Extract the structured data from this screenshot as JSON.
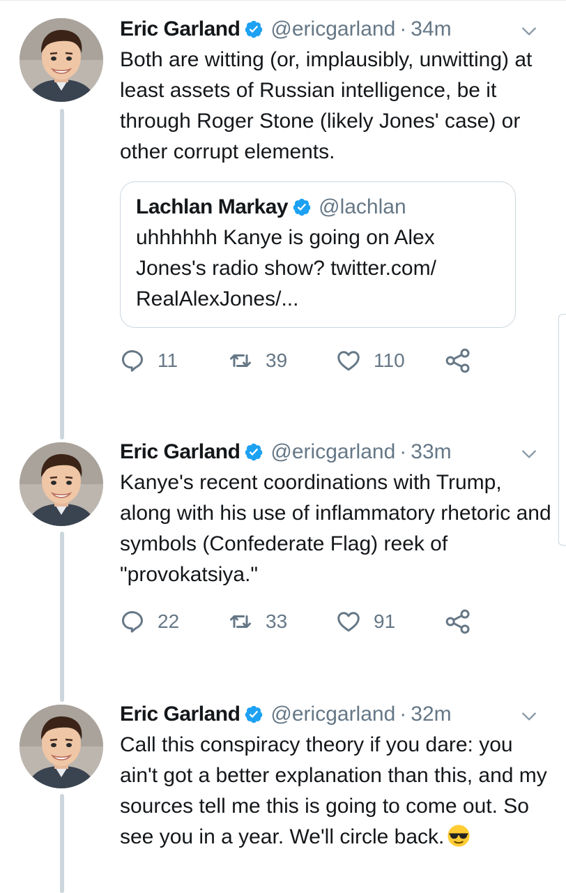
{
  "colors": {
    "accent": "#1da1f2",
    "secondary_text": "#657786",
    "thread_line": "#ccd6dd"
  },
  "tweets": [
    {
      "name": "Eric Garland",
      "handle": "@ericgarland",
      "separator": "·",
      "time": "34m",
      "text": "Both are witting (or, implausibly, unwitting) at least assets of Russian intelligence, be it through Roger Stone (likely Jones' case) or other corrupt elements.",
      "quote": {
        "name": "Lachlan Markay",
        "handle": "@lachlan",
        "text": "uhhhhhh Kanye is going on Alex Jones's radio show? twitter.com/ RealAlexJones/..."
      },
      "replies": "11",
      "retweets": "39",
      "likes": "110"
    },
    {
      "name": "Eric Garland",
      "handle": "@ericgarland",
      "separator": "·",
      "time": "33m",
      "text": "Kanye's recent coordinations with Trump, along with his use of inflammatory rhetoric and symbols (Confederate Flag) reek of \"provokatsiya.\"",
      "replies": "22",
      "retweets": "33",
      "likes": "91"
    },
    {
      "name": "Eric Garland",
      "handle": "@ericgarland",
      "separator": "·",
      "time": "32m",
      "text": "Call this conspiracy theory if you dare: you ain't got a better explanation than this, and my sources tell me this is going to come out. So see you in a year. We'll circle back.",
      "emoji": "sunglasses-emoji"
    }
  ]
}
